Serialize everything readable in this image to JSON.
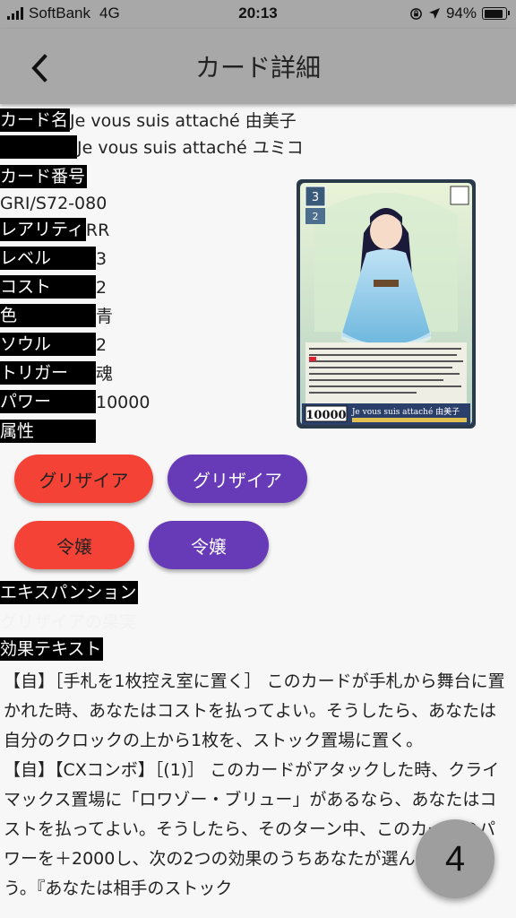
{
  "status_bar": {
    "carrier": "SoftBank",
    "network": "4G",
    "time": "20:13",
    "battery": "94%"
  },
  "app_bar": {
    "title": "カード詳細",
    "back_icon": "chevron-left-icon"
  },
  "card": {
    "name_label": "カード名",
    "name": "Je vous suis attaché 由美子",
    "kana": "Je vous suis attaché ユミコ",
    "number_label": "カード番号",
    "number": "GRI/S72-080",
    "rarity_label": "レアリティ",
    "rarity": "RR",
    "level_label": "レベル",
    "level": "3",
    "cost_label": "コスト",
    "cost": "2",
    "color_label": "色",
    "color": "青",
    "soul_label": "ソウル",
    "soul": "2",
    "trigger_label": "トリガー",
    "trigger": "魂",
    "power_label": "パワー",
    "power": "10000",
    "attribute_label": "属性",
    "image_power": "10000",
    "image_name": "Je vous suis attaché 由美子"
  },
  "chips": [
    {
      "label": "グリザイア"
    },
    {
      "label": "グリザイア"
    },
    {
      "label": "令嬢"
    },
    {
      "label": "令嬢"
    }
  ],
  "expansion": {
    "label": "エキスパンション",
    "value": "グリザイアの果実"
  },
  "effect": {
    "label": "効果テキスト",
    "line1": "【自】［手札を1枚控え室に置く］ このカードが手札から舞台に置かれた時、あなたはコストを払ってよい。そうしたら、あなたは自分のクロックの上から1枚を、ストック置場に置く。",
    "line2": "【自】【CXコンボ】［(1)］ このカードがアタックした時、クライマックス置場に「ロワゾー・ブリュー」があるなら、あなたはコストを払ってよい。そうしたら、そのターン中、このカードのパワーを＋2000し、次の2つの効果のうちあなたが選んだ1つを行う。『あなたは相手のストック"
  },
  "fab": {
    "label": "4"
  },
  "colors": {
    "bar": "#a8a8a8",
    "red_chip": "#f44336",
    "purple_chip": "#673ab7"
  }
}
